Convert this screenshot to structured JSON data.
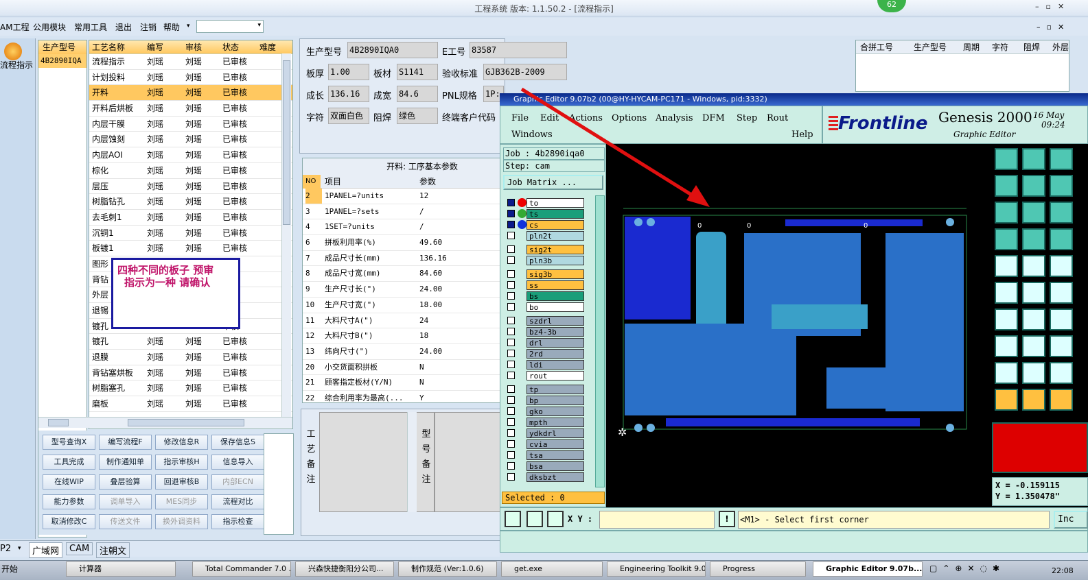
{
  "window": {
    "title": "工程系统  版本: 1.1.50.2 - [流程指示]",
    "badge": "62"
  },
  "menu": {
    "items": [
      "AM工程",
      "公用模块",
      "常用工具",
      "退出",
      "注销",
      "帮助"
    ]
  },
  "left_nav": {
    "button": "流程指示"
  },
  "model_list": {
    "header": "生产型号",
    "row": "4B2890IQA"
  },
  "process_table": {
    "headers": [
      "工艺名称",
      "编写",
      "审核",
      "状态",
      "难度"
    ],
    "rows": [
      [
        "流程指示",
        "刘瑶",
        "刘瑶",
        "已审核"
      ],
      [
        "计划投料",
        "刘瑶",
        "刘瑶",
        "已审核"
      ],
      [
        "开料",
        "刘瑶",
        "刘瑶",
        "已审核"
      ],
      [
        "开料后烘板",
        "刘瑶",
        "刘瑶",
        "已审核"
      ],
      [
        "内层干膜",
        "刘瑶",
        "刘瑶",
        "已审核"
      ],
      [
        "内层蚀刻",
        "刘瑶",
        "刘瑶",
        "已审核"
      ],
      [
        "内层AOI",
        "刘瑶",
        "刘瑶",
        "已审核"
      ],
      [
        "棕化",
        "刘瑶",
        "刘瑶",
        "已审核"
      ],
      [
        "层压",
        "刘瑶",
        "刘瑶",
        "已审核"
      ],
      [
        "树脂钻孔",
        "刘瑶",
        "刘瑶",
        "已审核"
      ],
      [
        "去毛刺1",
        "刘瑶",
        "刘瑶",
        "已审核"
      ],
      [
        "沉铜1",
        "刘瑶",
        "刘瑶",
        "已审核"
      ],
      [
        "板镀1",
        "刘瑶",
        "刘瑶",
        "已审核"
      ],
      [
        "图形",
        "",
        "",
        "审核"
      ],
      [
        "背钻",
        "",
        "",
        "审核"
      ],
      [
        "外层",
        "",
        "",
        "审核"
      ],
      [
        "退锡",
        "",
        "",
        "审核"
      ],
      [
        "镀孔",
        "",
        "",
        "审核"
      ],
      [
        "镀孔",
        "刘瑶",
        "刘瑶",
        "已审核"
      ],
      [
        "退膜",
        "刘瑶",
        "刘瑶",
        "已审核"
      ],
      [
        "背钻塞烘板",
        "刘瑶",
        "刘瑶",
        "已审核"
      ],
      [
        "树脂塞孔",
        "刘瑶",
        "刘瑶",
        "已审核"
      ],
      [
        "磨板",
        "刘瑶",
        "刘瑶",
        "已审核"
      ]
    ],
    "selected_index": 2
  },
  "annotation": {
    "line1": "四种不同的板子   预审",
    "line2": "指示为一种    请确认"
  },
  "buttons": [
    [
      "型号查询X",
      "编写流程F",
      "修改信息R",
      "保存信息S"
    ],
    [
      "工具完成",
      "制作通知单",
      "指示审核H",
      "信息导入"
    ],
    [
      "在线WIP",
      "叠层验算",
      "回退审核B",
      "内部ECN"
    ],
    [
      "能力参数",
      "调单导入",
      "MES同步",
      "流程对比"
    ],
    [
      "取消修改C",
      "传送文件",
      "换外调资料",
      "指示检查"
    ]
  ],
  "buttons_disabled": [
    "内部ECN",
    "调单导入",
    "MES同步",
    "传送文件",
    "换外调资料"
  ],
  "info": {
    "model_label": "生产型号",
    "model": "4B2890IQA0",
    "eno_label": "E工号",
    "eno": "83587",
    "thick_label": "板厚",
    "thick": "1.00",
    "mat_label": "板材",
    "mat": "S1141",
    "std_label": "验收标准",
    "std": "GJB362B-2009",
    "len_label": "成长",
    "len": "136.16",
    "wid_label": "成宽",
    "wid": "84.6",
    "pnl_label": "PNL规格",
    "pnl": "1P:",
    "char_label": "字符",
    "char": "双面白色",
    "mask_label": "阻焊",
    "mask": "绿色",
    "cust_label": "终端客户代码"
  },
  "params": {
    "title": "开料: 工序基本参数",
    "headers": [
      "NO",
      "项目",
      "参数"
    ],
    "rows": [
      [
        "2",
        "1PANEL=?units",
        "12"
      ],
      [
        "3",
        "1PANEL=?sets",
        "/"
      ],
      [
        "4",
        "1SET=?units",
        "/"
      ],
      [
        "6",
        "拼板利用率(%)",
        "49.60"
      ],
      [
        "7",
        "成品尺寸长(mm)",
        "136.16"
      ],
      [
        "8",
        "成品尺寸宽(mm)",
        "84.60"
      ],
      [
        "9",
        "生产尺寸长(\")",
        "24.00"
      ],
      [
        "10",
        "生产尺寸宽(\")",
        "18.00"
      ],
      [
        "11",
        "大料尺寸A(\")",
        "24"
      ],
      [
        "12",
        "大料尺寸B(\")",
        "18"
      ],
      [
        "13",
        "纬向尺寸(\")",
        "24.00"
      ],
      [
        "20",
        "小交货面积拼板",
        "N"
      ],
      [
        "21",
        "顾客指定板材(Y/N)",
        "N"
      ],
      [
        "22",
        "综合利用率为最高(...",
        "Y"
      ]
    ]
  },
  "notes": {
    "proc_label": [
      "工",
      "艺",
      "备",
      "注"
    ],
    "model_label": [
      "型",
      "号",
      "备",
      "注"
    ]
  },
  "right_table": {
    "headers": [
      "合拼工号",
      "生产型号",
      "周期",
      "字符",
      "阻焊",
      "外层"
    ]
  },
  "bottom_tabs": [
    "广域网",
    "CAM",
    "注朝文"
  ],
  "bottom_left": "P2",
  "genesis": {
    "title": "Graphic Editor 9.07b2 (00@HY-HYCAM-PC171 - Windows, pid:3332)",
    "menu": [
      "File",
      "Edit",
      "Actions",
      "Options",
      "Analysis",
      "DFM",
      "Step",
      "Rout",
      "Windows",
      "Help"
    ],
    "logo": "Frontline",
    "product": "Genesis 2000",
    "subtitle": "Graphic Editor",
    "date": "16 May",
    "time": "09:24",
    "job": "Job : 4b2890iqa0",
    "step": "Step: cam",
    "matrix": "Job Matrix ...",
    "layers": [
      "to",
      "ts",
      "cs",
      "pln2t",
      "sig2t",
      "pln3b",
      "sig3b",
      "ss",
      "bs",
      "bo",
      "szdrl",
      "bz4-3b",
      "drl",
      "2rd",
      "ldi",
      "rout",
      "tp",
      "bp",
      "gko",
      "mpth",
      "ydkdrl",
      "cvia",
      "tsa",
      "bsa",
      "dksbzt"
    ],
    "layer_colors": [
      "#ffffff",
      "#1a9e7a",
      "#ffc040",
      "#b0d8e0",
      "#ffc040",
      "#b0d8e0",
      "#ffc040",
      "#ffc040",
      "#1a9e7a",
      "#ffffff",
      "#9ab",
      "#9ab",
      "#9ab",
      "#9ab",
      "#9ab",
      "#ffffff",
      "#9ab",
      "#9ab",
      "#9ab",
      "#9ab",
      "#9ab",
      "#9ab",
      "#9ab",
      "#9ab",
      "#9ab"
    ],
    "selected": "Selected : 0",
    "xy_label": "X Y :",
    "prompt": "<M1> - Select first corner",
    "incr": "Inc",
    "coord_x": "X = -0.159115",
    "coord_y": "Y = 1.350478\"",
    "board_marks": [
      "0",
      "0",
      "0"
    ]
  },
  "taskbar": {
    "start": "开始",
    "items": [
      "计算器",
      "Total Commander 7.0 ...",
      "兴森快捷衡阳分公司...",
      "制作规范 (Ver:1.0.6)",
      "get.exe",
      "Engineering Toolkit 9.0...",
      "Progress",
      "Graphic Editor 9.07b..."
    ],
    "clock": "22:08"
  }
}
